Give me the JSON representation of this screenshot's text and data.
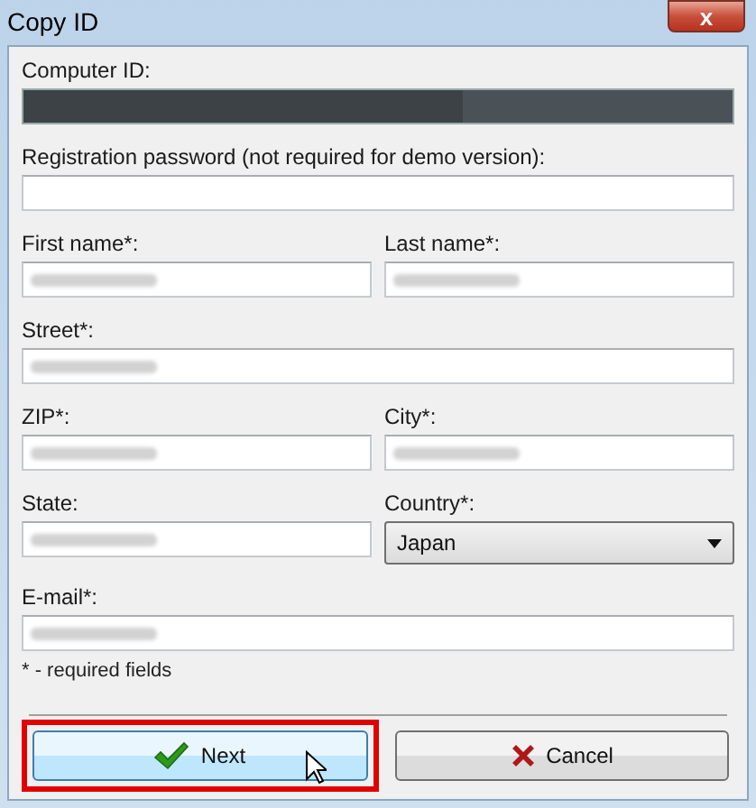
{
  "window": {
    "title": "Copy ID",
    "close_button": "x"
  },
  "rows": [
    [
      {
        "label": "Computer ID:",
        "kind": "redacted"
      }
    ],
    [
      {
        "label": "Registration password (not required for demo version):",
        "kind": "text"
      }
    ],
    [
      {
        "label": "First name*:",
        "kind": "blurred"
      },
      {
        "label": "Last name*:",
        "kind": "blurred"
      }
    ],
    [
      {
        "label": "Street*:",
        "kind": "blurred"
      }
    ],
    [
      {
        "label": "ZIP*:",
        "kind": "blurred"
      },
      {
        "label": "City*:",
        "kind": "blurred"
      }
    ],
    [
      {
        "label": "State:",
        "kind": "blurred"
      },
      {
        "label": "Country*:",
        "kind": "select",
        "value": "Japan"
      }
    ],
    [
      {
        "label": "E-mail*:",
        "kind": "blurred"
      }
    ]
  ],
  "note": "* - required fields",
  "buttons": [
    {
      "label": "Next",
      "kind": "ok",
      "highlighted": true
    },
    {
      "label": "Cancel",
      "kind": "cancel",
      "highlighted": false
    }
  ]
}
